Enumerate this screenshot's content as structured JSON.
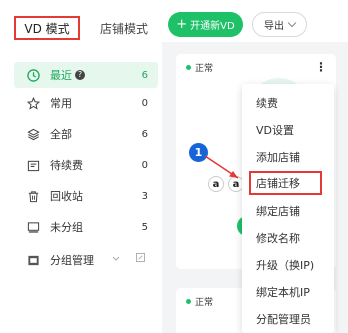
{
  "header": {
    "tab_vd": "VD 模式",
    "tab_store": "店铺模式",
    "open_vd": "开通新VD",
    "export": "导出"
  },
  "sidebar": {
    "items": [
      {
        "label": "最近",
        "count": "6",
        "icon": "clock-icon"
      },
      {
        "label": "常用",
        "count": "0",
        "icon": "star-icon"
      },
      {
        "label": "全部",
        "count": "6",
        "icon": "layers-icon"
      },
      {
        "label": "待续费",
        "count": "0",
        "icon": "calendar-icon"
      },
      {
        "label": "回收站",
        "count": "3",
        "icon": "trash-icon"
      },
      {
        "label": "未分组",
        "count": "5",
        "icon": "monitor-icon"
      },
      {
        "label": "分组管理",
        "count": "",
        "icon": "folder-icon"
      }
    ],
    "help": "?"
  },
  "cards": [
    {
      "status": "正常"
    },
    {
      "status": "正常"
    }
  ],
  "annotation": {
    "step": "1"
  },
  "store_icons": [
    "a",
    "a"
  ],
  "context_menu": {
    "items": [
      "续费",
      "VD设置",
      "添加店铺",
      "店铺迁移",
      "绑定店铺",
      "修改名称",
      "升级（换IP)",
      "绑定本机IP",
      "分配管理员"
    ],
    "highlighted": "店铺迁移"
  },
  "colors": {
    "accent": "#1ec168",
    "highlight_border": "#e53935",
    "annotation_badge": "#1565d8"
  }
}
